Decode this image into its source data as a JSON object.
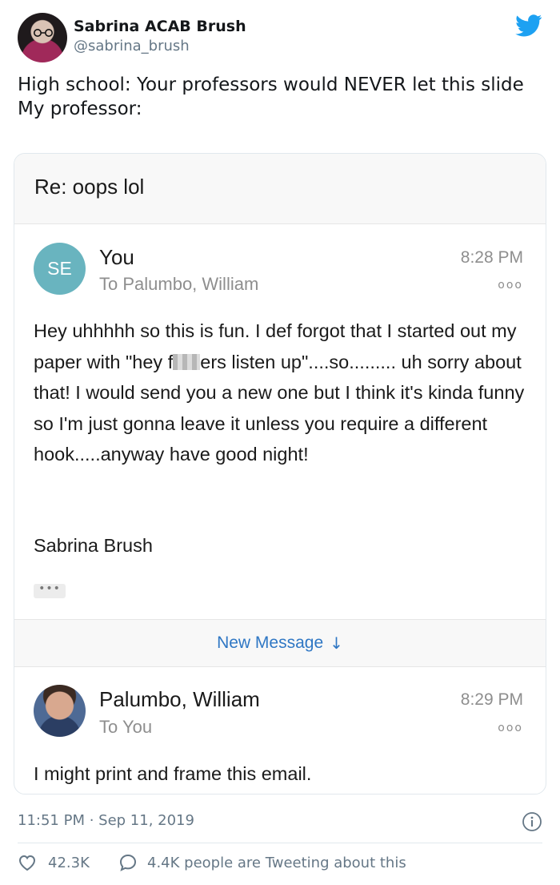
{
  "author": {
    "name": "Sabrina ACAB Brush",
    "handle": "@sabrina_brush"
  },
  "tweet": {
    "line1": "High school: Your professors would NEVER let this slide",
    "line2": "My professor:"
  },
  "email": {
    "subject": "Re: oops lol",
    "message1": {
      "avatar_initials": "SE",
      "from": "You",
      "to": "To Palumbo, William",
      "time": "8:28 PM",
      "more": "ooo",
      "body_part1": "Hey uhhhhh so this is fun. I def forgot that I started out my paper with \"hey f",
      "body_part2": "ers listen up\"....so......... uh sorry about that! I would send you a new one but I think it's kinda funny so I'm just gonna leave it unless you require a different hook.....anyway have good night!",
      "signature": "Sabrina Brush",
      "trimmed_indicator": "•••"
    },
    "new_message": {
      "label": "New Message",
      "arrow": "↓"
    },
    "message2": {
      "from": "Palumbo, William",
      "to": "To You",
      "time": "8:29 PM",
      "more": "ooo",
      "body": "I might print and frame this email."
    }
  },
  "footer": {
    "timestamp": "11:51 PM · Sep 11, 2019",
    "likes": "42.3K",
    "tweeting": "4.4K people are Tweeting about this"
  },
  "colors": {
    "twitter_blue": "#1da1f2",
    "link_blue": "#2f77c4",
    "avatar_teal": "#69b4bf",
    "secondary_text": "#657786"
  },
  "icons": [
    "twitter-bird-icon",
    "info-icon",
    "heart-icon",
    "reply-bubble-icon",
    "arrow-down-icon"
  ]
}
